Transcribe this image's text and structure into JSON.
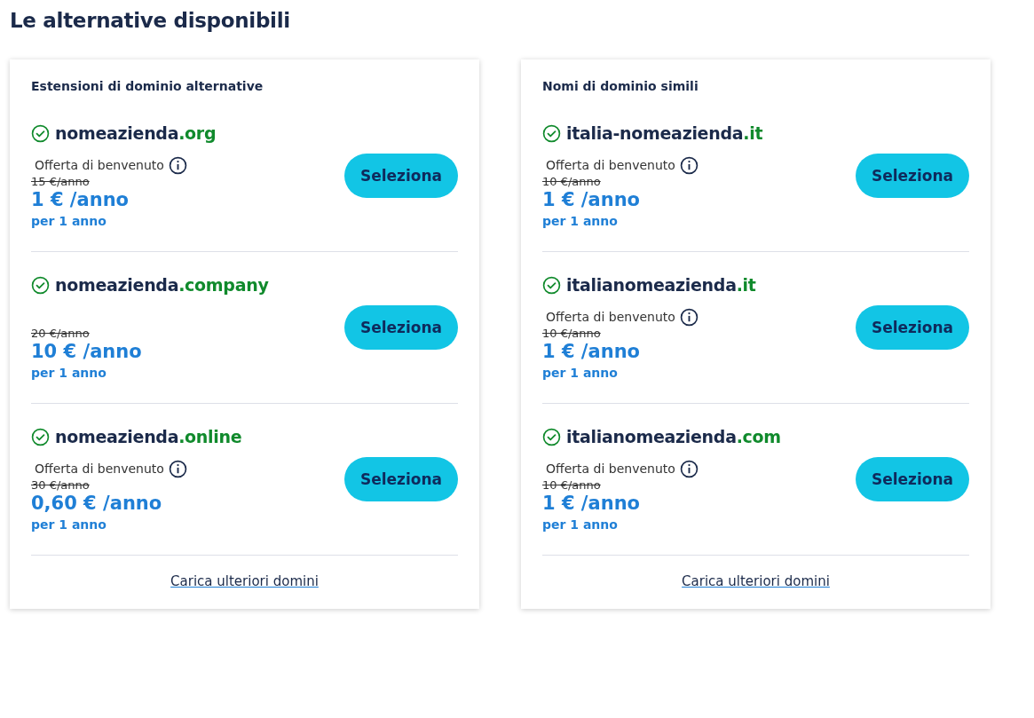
{
  "title": "Le alternative disponibili",
  "panels": [
    {
      "heading": "Estensioni di dominio alternative",
      "items": [
        {
          "name": "nomeazienda",
          "tld": ".org",
          "available": true,
          "offer": "Offerta di benvenuto",
          "old_price": "15 €/anno",
          "price": "1 € /anno",
          "term": "per 1 anno",
          "button": "Seleziona"
        },
        {
          "name": "nomeazienda",
          "tld": ".company",
          "available": true,
          "old_price": "20 €/anno",
          "price": "10 € /anno",
          "term": "per 1 anno",
          "button": "Seleziona"
        },
        {
          "name": "nomeazienda",
          "tld": ".online",
          "available": true,
          "offer": "Offerta di benvenuto",
          "old_price": "30 €/anno",
          "price": "0,60 € /anno",
          "term": "per 1 anno",
          "button": "Seleziona"
        }
      ],
      "more_link": "Carica ulteriori domini"
    },
    {
      "heading": "Nomi di dominio simili",
      "items": [
        {
          "name": "italia-nomeazienda",
          "tld": ".it",
          "available": true,
          "offer": "Offerta di benvenuto",
          "old_price": "10 €/anno",
          "price": "1 € /anno",
          "term": "per 1 anno",
          "button": "Seleziona"
        },
        {
          "name": "italianomeazienda",
          "tld": ".it",
          "available": true,
          "offer": "Offerta di benvenuto",
          "old_price": "10 €/anno",
          "price": "1 € /anno",
          "term": "per 1 anno",
          "button": "Seleziona"
        },
        {
          "name": "italianomeazienda",
          "tld": ".com",
          "available": true,
          "offer": "Offerta di benvenuto",
          "old_price": "10 €/anno",
          "price": "1 € /anno",
          "term": "per 1 anno",
          "button": "Seleziona"
        }
      ],
      "more_link": "Carica ulteriori domini"
    }
  ]
}
